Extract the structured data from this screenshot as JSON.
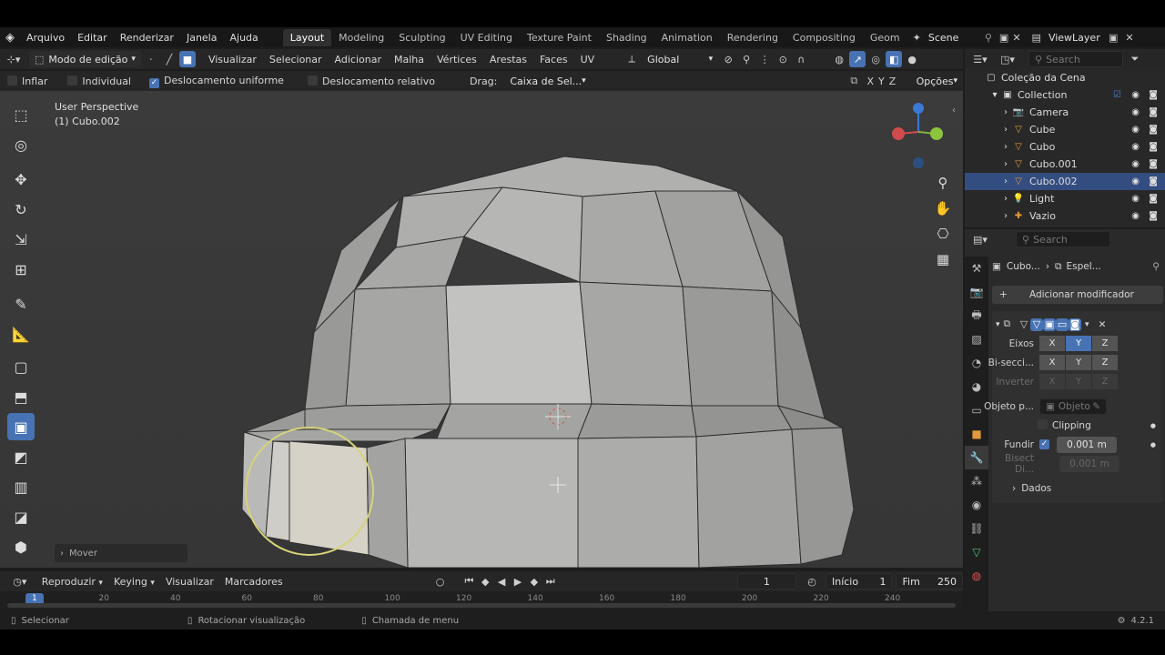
{
  "app": {
    "logo_icon": "blender-icon"
  },
  "menus": [
    "Arquivo",
    "Editar",
    "Renderizar",
    "Janela",
    "Ajuda"
  ],
  "workspaces": [
    "Layout",
    "Modeling",
    "Sculpting",
    "UV Editing",
    "Texture Paint",
    "Shading",
    "Animation",
    "Rendering",
    "Compositing",
    "Geom"
  ],
  "active_workspace": "Layout",
  "scene": {
    "name": "Scene"
  },
  "viewlayer": {
    "name": "ViewLayer"
  },
  "header": {
    "mode": "Modo de edição",
    "menus": [
      "Visualizar",
      "Selecionar",
      "Adicionar",
      "Malha",
      "Vértices",
      "Arestas",
      "Faces",
      "UV"
    ],
    "orientation": "Global"
  },
  "toolset": {
    "inflar": "Inflar",
    "individual": "Individual",
    "uniform": "Deslocamento uniforme",
    "relative": "Deslocamento relativo",
    "drag_label": "Drag:",
    "drag_value": "Caixa de Sel...",
    "x": "X",
    "y": "Y",
    "z": "Z",
    "options": "Opções"
  },
  "viewport": {
    "perspective": "User Perspective",
    "object": "(1) Cubo.002",
    "last_op": "Mover",
    "colors": {
      "bg": "#393939",
      "mesh": "#a9aaa8",
      "accent": "#4772b3"
    }
  },
  "timeline": {
    "menus": [
      "Reproduzir",
      "Keying",
      "Visualizar",
      "Marcadores"
    ],
    "frame": "1",
    "start_label": "Início",
    "start": "1",
    "end_label": "Fim",
    "end": "250",
    "ticks": [
      "1",
      "20",
      "40",
      "60",
      "80",
      "100",
      "120",
      "140",
      "160",
      "180",
      "200",
      "220",
      "240"
    ]
  },
  "status": {
    "select": "Selecionar",
    "rotate": "Rotacionar visualização",
    "menu": "Chamada de menu",
    "version": "4.2.1"
  },
  "outliner": {
    "search_placeholder": "Search",
    "scene_collection": "Coleção da Cena",
    "collection": "Collection",
    "items": [
      {
        "name": "Camera",
        "icon": "camera-icon",
        "selected": false
      },
      {
        "name": "Cube",
        "icon": "mesh-icon",
        "selected": false
      },
      {
        "name": "Cubo",
        "icon": "mesh-icon",
        "selected": false
      },
      {
        "name": "Cubo.001",
        "icon": "mesh-icon",
        "selected": false
      },
      {
        "name": "Cubo.002",
        "icon": "mesh-icon",
        "selected": true
      },
      {
        "name": "Light",
        "icon": "light-icon",
        "selected": false
      },
      {
        "name": "Vazio",
        "icon": "empty-icon",
        "selected": false
      }
    ]
  },
  "properties": {
    "search_placeholder": "Search",
    "breadcrumb_obj": "Cubo...",
    "breadcrumb_mod": "Espel...",
    "add_modifier": "Adicionar modificador",
    "axes_label": "Eixos",
    "bisect_label": "Bi-secci...",
    "invert_label": "Inverter",
    "x": "X",
    "y": "Y",
    "z": "Z",
    "mirror_obj_label": "Objeto p...",
    "mirror_obj_placeholder": "Objeto",
    "clipping": "Clipping",
    "merge_label": "Fundir",
    "merge_value": "0.001 m",
    "bisect_dist_label": "Bisect Di...",
    "bisect_dist_value": "0.001 m",
    "data_panel": "Dados"
  }
}
